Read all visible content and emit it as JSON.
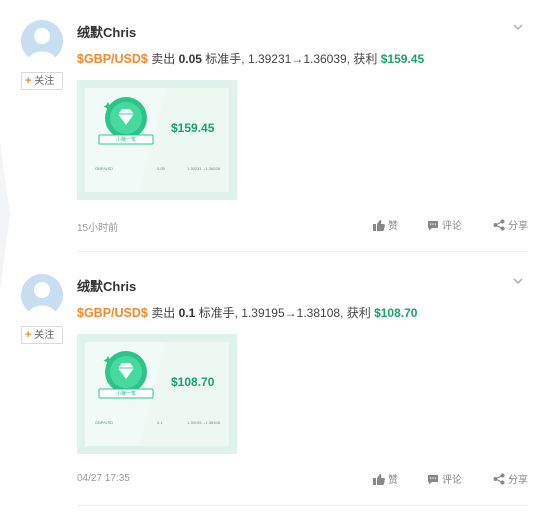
{
  "posts": [
    {
      "username": "绒默Chris",
      "follow_label": "关注",
      "symbol": "$GBP/USD$",
      "action": "卖出",
      "lots": "0.05",
      "lot_unit": "标准手,",
      "price_range": "1.39231→1.36039,",
      "profit_label": "获利",
      "profit": "$159.45",
      "card": {
        "amount": "$159.45",
        "medal_label": "小赚一笔",
        "pair": "GBP/USD",
        "lots": "0.05",
        "prices": "1.39231→1.36039"
      },
      "time": "15小时前",
      "like_label": "赞",
      "comment_label": "评论",
      "share_label": "分享"
    },
    {
      "username": "绒默Chris",
      "follow_label": "关注",
      "symbol": "$GBP/USD$",
      "action": "卖出",
      "lots": "0.1",
      "lot_unit": "标准手,",
      "price_range": "1.39195→1.38108,",
      "profit_label": "获利",
      "profit": "$108.70",
      "card": {
        "amount": "$108.70",
        "medal_label": "小赚一笔",
        "pair": "GBP/USD",
        "lots": "0.1",
        "prices": "1.39195→1.38108"
      },
      "time": "04/27 17:35",
      "like_label": "赞",
      "comment_label": "评论",
      "share_label": "分享"
    }
  ],
  "colors": {
    "symbol": "#f08a2b",
    "profit": "#1aa26e",
    "medal": "#2bc48a",
    "muted": "#999999"
  },
  "icons": [
    "avatar-placeholder-icon",
    "plus-icon",
    "chevron-down-icon",
    "thumbs-up-icon",
    "comment-icon",
    "share-icon",
    "diamond-medal-icon"
  ]
}
